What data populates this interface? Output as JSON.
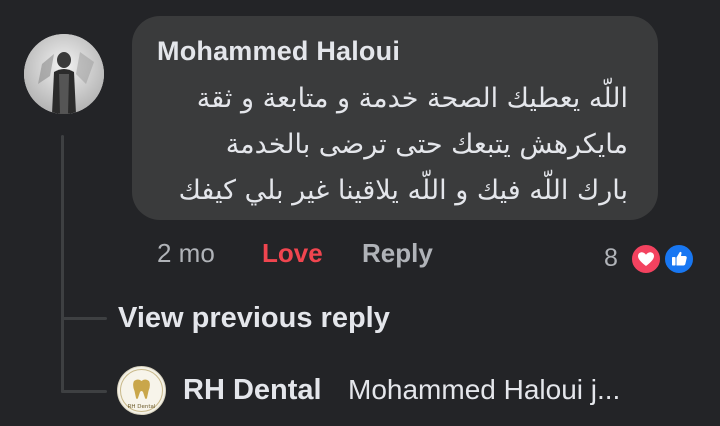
{
  "comment": {
    "author": "Mohammed Haloui",
    "lines": [
      "اللّه يعطيك الصحة خدمة و متابعة و ثقة",
      "مايكرهش يتبعك حتى ترضى بالخدمة",
      "بارك اللّه فيك و اللّه يلاقينا غير بلي كيفك"
    ],
    "time": "2 mo",
    "love_label": "Love",
    "reply_label": "Reply",
    "reaction_count": "8",
    "reaction_icons": [
      "heart-icon",
      "thumbs-up-icon"
    ],
    "love_color": "#f0454f"
  },
  "thread": {
    "view_previous_label": "View previous reply"
  },
  "reply_preview": {
    "author": "RH Dental",
    "text": "Mohammed Haloui j...",
    "logo_text": "RH Dental"
  }
}
